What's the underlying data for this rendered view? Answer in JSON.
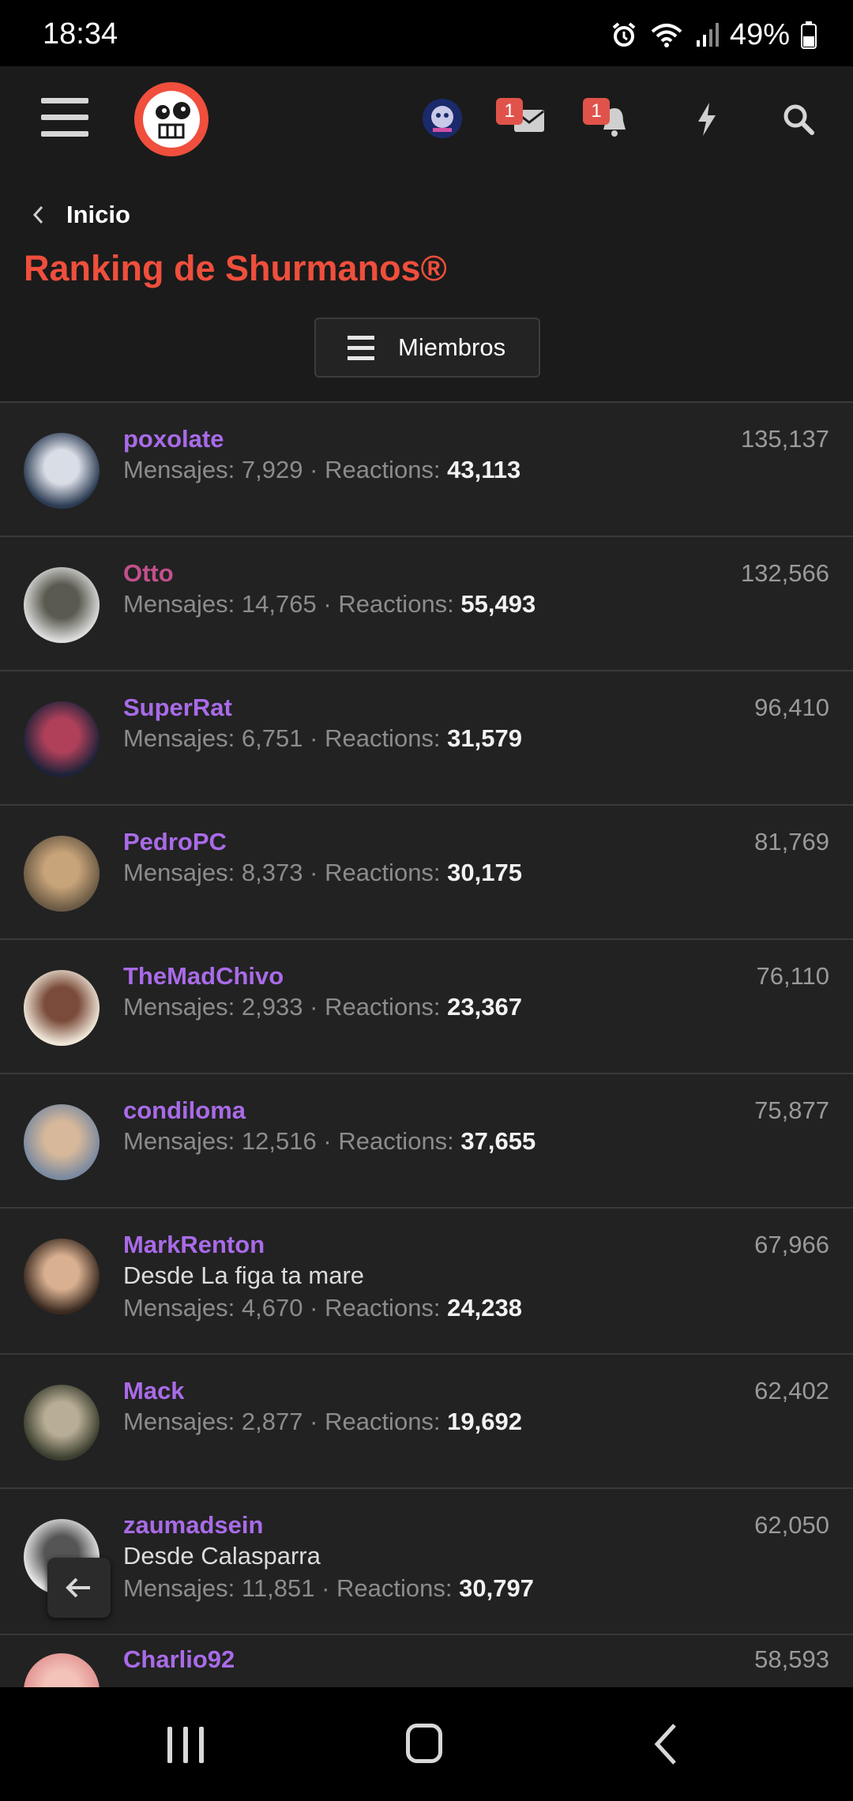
{
  "status_bar": {
    "time": "18:34",
    "battery": "49%"
  },
  "header": {
    "badges": {
      "messages": "1",
      "alerts": "1"
    },
    "colors": {
      "accent": "#ef4f3c",
      "username": "#a96be8",
      "username_alt": "#c2508c",
      "background": "#222222"
    }
  },
  "breadcrumb": {
    "label": "Inicio"
  },
  "page": {
    "title": "Ranking de Shurmanos®",
    "filter_label": "Miembros"
  },
  "labels": {
    "messages": "Mensajes:",
    "reactions": "Reactions:",
    "sep": "·"
  },
  "members": [
    {
      "name": "poxolate",
      "location": "",
      "messages": "7,929",
      "reactions": "43,113",
      "score": "135,137"
    },
    {
      "name": "Otto",
      "location": "",
      "messages": "14,765",
      "reactions": "55,493",
      "score": "132,566"
    },
    {
      "name": "SuperRat",
      "location": "",
      "messages": "6,751",
      "reactions": "31,579",
      "score": "96,410"
    },
    {
      "name": "PedroPC",
      "location": "",
      "messages": "8,373",
      "reactions": "30,175",
      "score": "81,769"
    },
    {
      "name": "TheMadChivo",
      "location": "",
      "messages": "2,933",
      "reactions": "23,367",
      "score": "76,110"
    },
    {
      "name": "condiloma",
      "location": "",
      "messages": "12,516",
      "reactions": "37,655",
      "score": "75,877"
    },
    {
      "name": "MarkRenton",
      "location": "Desde La figa ta mare",
      "messages": "4,670",
      "reactions": "24,238",
      "score": "67,966"
    },
    {
      "name": "Mack",
      "location": "",
      "messages": "2,877",
      "reactions": "19,692",
      "score": "62,402"
    },
    {
      "name": "zaumadsein",
      "location": "Desde Calasparra",
      "messages": "11,851",
      "reactions": "30,797",
      "score": "62,050"
    },
    {
      "name": "Charlio92",
      "location": "",
      "messages": "",
      "reactions": "",
      "score": "58,593"
    }
  ]
}
